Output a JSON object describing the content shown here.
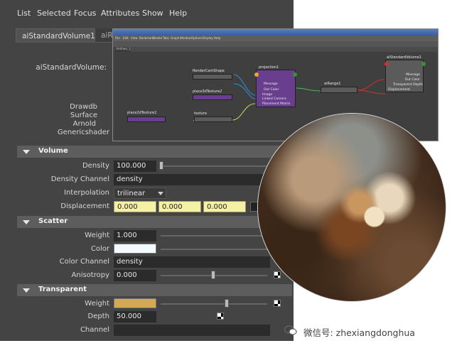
{
  "menu": [
    "List",
    "Selected",
    "Focus",
    "Attributes",
    "Show",
    "Help"
  ],
  "tabs": [
    "aiStandardVolume1",
    "aiRa"
  ],
  "node_type_label": "aiStandardVolume:",
  "sections_static": [
    "Drawdb",
    "Surface",
    "Arnold",
    "Genericshader"
  ],
  "volume": {
    "title": "Volume",
    "density_label": "Density",
    "density": "100.000",
    "density_channel_label": "Density Channel",
    "density_channel": "density",
    "interpolation_label": "Interpolation",
    "interpolation": "trilinear",
    "displacement_label": "Displacement",
    "displacement": [
      "0.000",
      "0.000",
      "0.000"
    ]
  },
  "scatter": {
    "title": "Scatter",
    "weight_label": "Weight",
    "weight": "1.000",
    "color_label": "Color",
    "color_channel_label": "Color Channel",
    "color_channel": "density",
    "anisotropy_label": "Anisotropy",
    "anisotropy": "0.000"
  },
  "transparent": {
    "title": "Transparent",
    "weight_label": "Weight",
    "depth_label": "Depth",
    "depth": "50.000",
    "channel_label": "Channel"
  },
  "colors": {
    "scatter_color": "#f4fbff",
    "transparent_color": "#d4a954",
    "accent": "#6a4e8e"
  },
  "hypershade": {
    "menu": [
      "File",
      "Edit",
      "View",
      "Bookmarks",
      "Create",
      "Tabs",
      "Graph",
      "Window",
      "Options",
      "Display",
      "Help"
    ],
    "tab": "Untitled_1",
    "nodes": {
      "render_cam": "RenderCamShape",
      "place3d": "place3dTexture2",
      "place2d": "place2dTexture2",
      "texture": "texture",
      "projection": "projection1",
      "projection_ports": [
        "Message",
        "Out Color",
        "Image",
        "Linked Camera",
        "Placement Matrix"
      ],
      "airange": "aiRange1",
      "volume_node": "aiStandardVolume1",
      "volume_ports": [
        "Message",
        "Out Color",
        "Transparent Depth",
        "Displacement"
      ]
    }
  },
  "watermark": "微信号: zhexiangdonghua"
}
